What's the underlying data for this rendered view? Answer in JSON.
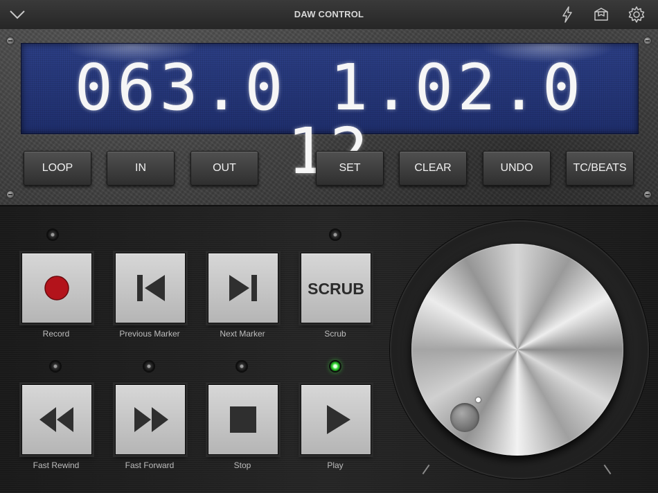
{
  "header": {
    "title": "DAW CONTROL",
    "icons": [
      "chevron-down-icon",
      "lightning-icon",
      "box-icon",
      "gear-icon"
    ]
  },
  "display": {
    "timecode": "06 30 1 02 012",
    "digits": "063.0 1.02.0 12"
  },
  "function_buttons": {
    "loop": "LOOP",
    "in": "IN",
    "out": "OUT",
    "set": "SET",
    "clear": "CLEAR",
    "undo": "UNDO",
    "tc_beats": "TC/BEATS"
  },
  "transport": {
    "record": "Record",
    "previous_marker": "Previous Marker",
    "next_marker": "Next Marker",
    "scrub": "Scrub",
    "scrub_button_text": "SCRUB",
    "fast_rewind": "Fast Rewind",
    "fast_forward": "Fast Forward",
    "stop": "Stop",
    "play": "Play"
  },
  "leds": {
    "record": "off",
    "scrub": "off",
    "fast_rewind": "off",
    "fast_forward": "off",
    "stop": "off",
    "play": "on"
  },
  "colors": {
    "lcd_background": "#24367a",
    "record_red": "#b3131b",
    "led_green": "#3ee83e"
  }
}
